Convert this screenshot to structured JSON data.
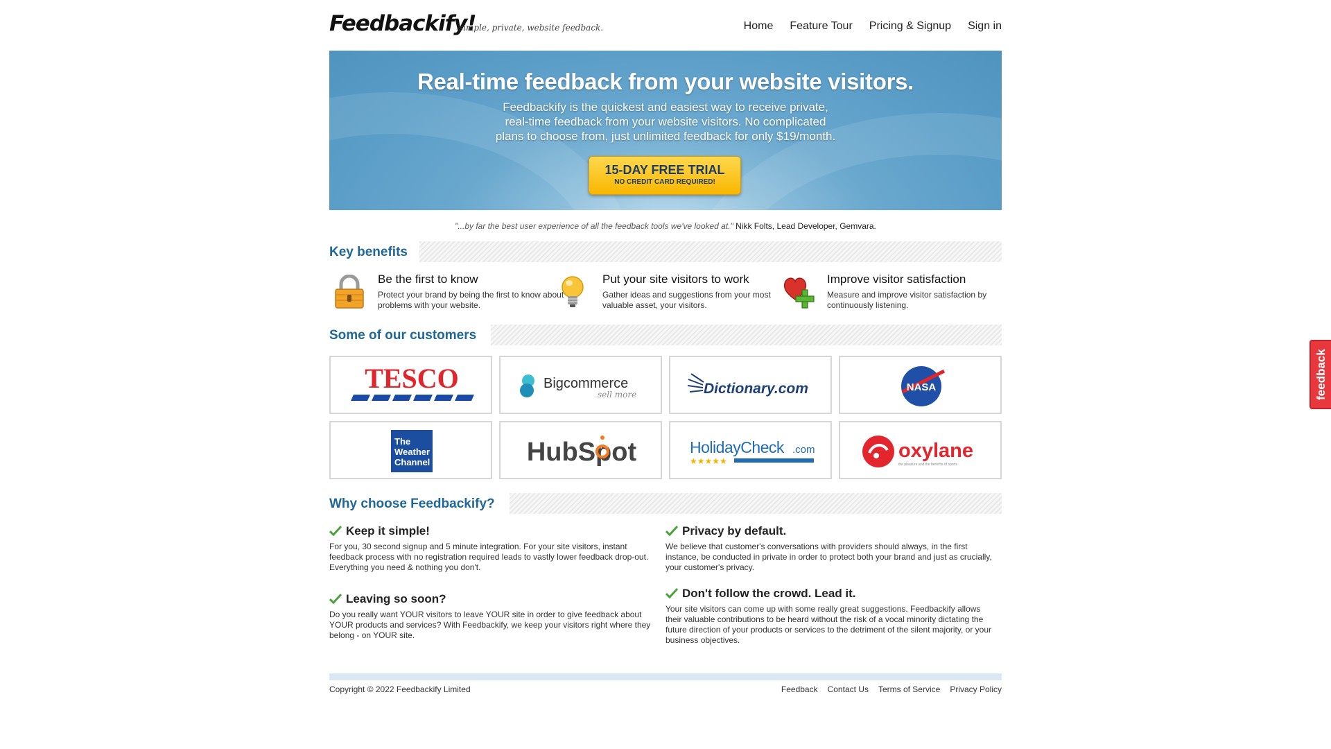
{
  "header": {
    "logo": "Feedbackify!",
    "tagline": "simple, private, website feedback.",
    "nav": [
      "Home",
      "Feature Tour",
      "Pricing & Signup",
      "Sign in"
    ]
  },
  "hero": {
    "title": "Real-time feedback from your website visitors.",
    "line1": "Feedbackify is the quickest and easiest way to receive private,",
    "line2": "real-time feedback from your website visitors. No complicated",
    "line3": "plans to choose from, just unlimited feedback for only $19/month.",
    "cta_main": "15-DAY FREE TRIAL",
    "cta_sub": "NO CREDIT CARD REQUIRED!"
  },
  "quote": {
    "text": "\"...by far the best user experience of all the feedback tools we've looked at.\"",
    "author": "Nikk Folts, Lead Developer, Gemvara."
  },
  "benefits": {
    "heading": "Key benefits",
    "items": [
      {
        "title": "Be the first to know",
        "desc": "Protect your brand by being the first to know about problems with your website.",
        "icon": "padlock-icon"
      },
      {
        "title": "Put your site visitors to work",
        "desc": "Gather ideas and suggestions from your most valuable asset, your visitors.",
        "icon": "lightbulb-icon"
      },
      {
        "title": "Improve visitor satisfaction",
        "desc": "Measure and improve visitor satisfaction by continuously listening.",
        "icon": "heart-plus-icon"
      }
    ]
  },
  "customers": {
    "heading": "Some of our customers",
    "logos": {
      "tesco": "TESCO",
      "bigcommerce": "Bigcommerce",
      "bigcommerce_sub": "sell more",
      "dictionary": "Dictionary.com",
      "nasa": "NASA",
      "weather_1": "The",
      "weather_2": "Weather",
      "weather_3": "Channel",
      "hubspot": "HubSpot",
      "holidaycheck": "HolidayCheck",
      "holidaycheck_com": ".com",
      "oxylane": "oxylane",
      "oxylane_sub": "the pleasure and the benefits of sports"
    }
  },
  "why": {
    "heading": "Why choose Feedbackify?",
    "items": [
      {
        "title": "Keep it simple!",
        "desc": "For you, 30 second signup and 5 minute integration. For your site visitors, instant feedback process with no registration required leads to vastly lower feedback drop-out. Everything you need & nothing you don't."
      },
      {
        "title": "Privacy by default.",
        "desc": "We believe that customer's conversations with providers should always, in the first instance, be conducted in private in order to protect both your brand and just as crucially, your customer's privacy."
      },
      {
        "title": "Leaving so soon?",
        "desc": "Do you really want YOUR visitors to leave YOUR site in order to give feedback about YOUR products and services? With Feedbackify, we keep your visitors right where they belong - on YOUR site."
      },
      {
        "title": "Don't follow the crowd. Lead it.",
        "desc": "Your site visitors can come up with some really great suggestions. Feedbackify allows their valuable contributions to be heard without the risk of a vocal minority dictating the future direction of your products or services to the detriment of the silent majority, or your business objectives."
      }
    ]
  },
  "footer": {
    "copyright": "Copyright © 2022 Feedbackify Limited",
    "links": [
      "Feedback",
      "Contact Us",
      "Terms of Service",
      "Privacy Policy"
    ]
  },
  "feedback_tab": "feedback",
  "colors": {
    "heading_blue": "#1f6699",
    "cta_yellow": "#f8b600",
    "feedback_red": "#e8383d"
  }
}
